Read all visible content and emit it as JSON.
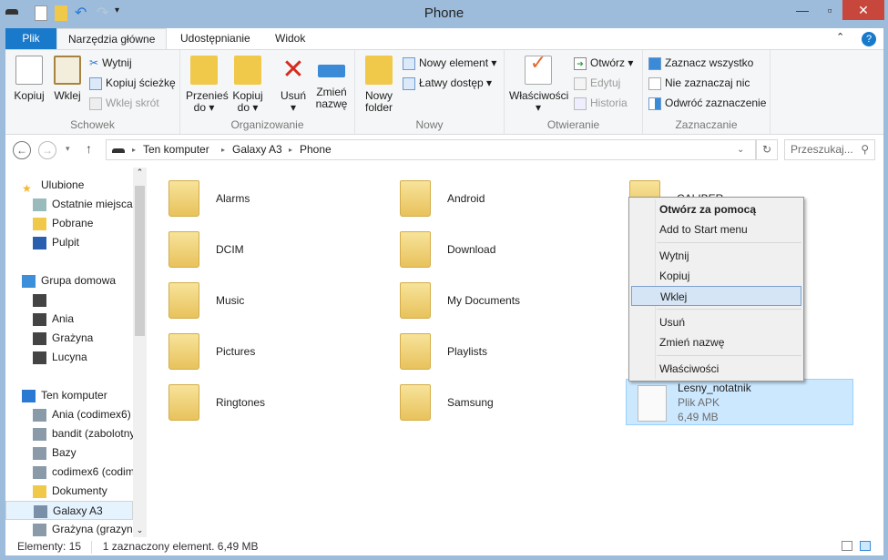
{
  "window": {
    "title": "Phone"
  },
  "ribbon_tabs": [
    "Plik",
    "Narzędzia główne",
    "Udostępnianie",
    "Widok"
  ],
  "ribbon": {
    "schowek": {
      "label": "Schowek",
      "kopiuj": "Kopiuj",
      "wklej": "Wklej",
      "wytnij": "Wytnij",
      "kopiuj_sciezke": "Kopiuj ścieżkę",
      "wklej_skrot": "Wklej skrót"
    },
    "organizowanie": {
      "label": "Organizowanie",
      "przenies": "Przenieś do ▾",
      "kopiuj_do": "Kopiuj do ▾",
      "usun": "Usuń ▾",
      "zmien": "Zmień nazwę"
    },
    "nowy": {
      "label": "Nowy",
      "folder": "Nowy folder",
      "element": "Nowy element ▾",
      "dostep": "Łatwy dostęp ▾"
    },
    "otwieranie": {
      "label": "Otwieranie",
      "wlasciwosci": "Właściwości ▾",
      "otworz": "Otwórz ▾",
      "edytuj": "Edytuj",
      "historia": "Historia"
    },
    "zaznaczanie": {
      "label": "Zaznaczanie",
      "wszystko": "Zaznacz wszystko",
      "nic": "Nie zaznaczaj nic",
      "odwroc": "Odwróć zaznaczenie"
    }
  },
  "address": {
    "path": [
      "Ten komputer",
      "Galaxy A3",
      "Phone"
    ],
    "search_placeholder": "Przeszukaj..."
  },
  "nav": [
    {
      "label": "Ulubione",
      "level": 0,
      "icon": "star-icon"
    },
    {
      "label": "Ostatnie miejsca",
      "level": 1,
      "icon": "recent-places-icon"
    },
    {
      "label": "Pobrane",
      "level": 1,
      "icon": "downloads-icon"
    },
    {
      "label": "Pulpit",
      "level": 1,
      "icon": "desktop-icon"
    },
    {
      "label": "Grupa domowa",
      "level": 0,
      "icon": "homegroup-icon",
      "gap": true
    },
    {
      "label": "",
      "level": 1,
      "icon": "user-icon"
    },
    {
      "label": "Ania",
      "level": 1,
      "icon": "user-icon"
    },
    {
      "label": "Grażyna",
      "level": 1,
      "icon": "user-icon"
    },
    {
      "label": "Lucyna",
      "level": 1,
      "icon": "user-icon"
    },
    {
      "label": "Ten komputer",
      "level": 0,
      "icon": "computer-icon",
      "gap": true
    },
    {
      "label": "Ania (codimex6)",
      "level": 1,
      "icon": "network-drive-icon"
    },
    {
      "label": "bandit (zabolotny",
      "level": 1,
      "icon": "network-drive-icon"
    },
    {
      "label": "Bazy",
      "level": 1,
      "icon": "network-drive-icon"
    },
    {
      "label": "codimex6 (codim",
      "level": 1,
      "icon": "network-drive-icon"
    },
    {
      "label": "Dokumenty",
      "level": 1,
      "icon": "documents-icon"
    },
    {
      "label": "Galaxy A3",
      "level": 1,
      "icon": "phone-icon",
      "selected": true
    },
    {
      "label": "Grażyna (grazyna",
      "level": 1,
      "icon": "network-drive-icon"
    }
  ],
  "folders": [
    [
      "Alarms",
      "Android",
      "CALIBER"
    ],
    [
      "DCIM",
      "Download"
    ],
    [
      "Music",
      "My Documents"
    ],
    [
      "Pictures",
      "Playlists"
    ],
    [
      "Ringtones",
      "Samsung"
    ]
  ],
  "selected_file": {
    "name": "Lesny_notatnik",
    "type": "Plik APK",
    "size": "6,49 MB"
  },
  "context_menu": [
    "Otwórz za pomocą",
    "Add to Start menu",
    "Wytnij",
    "Kopiuj",
    "Wklej",
    "Usuń",
    "Zmień nazwę",
    "Właściwości"
  ],
  "status": {
    "count": "Elementy: 15",
    "selection": "1 zaznaczony element. 6,49 MB"
  },
  "colors": {
    "accent": "#1979ca",
    "selection": "#cce8ff",
    "close": "#c7473c"
  }
}
